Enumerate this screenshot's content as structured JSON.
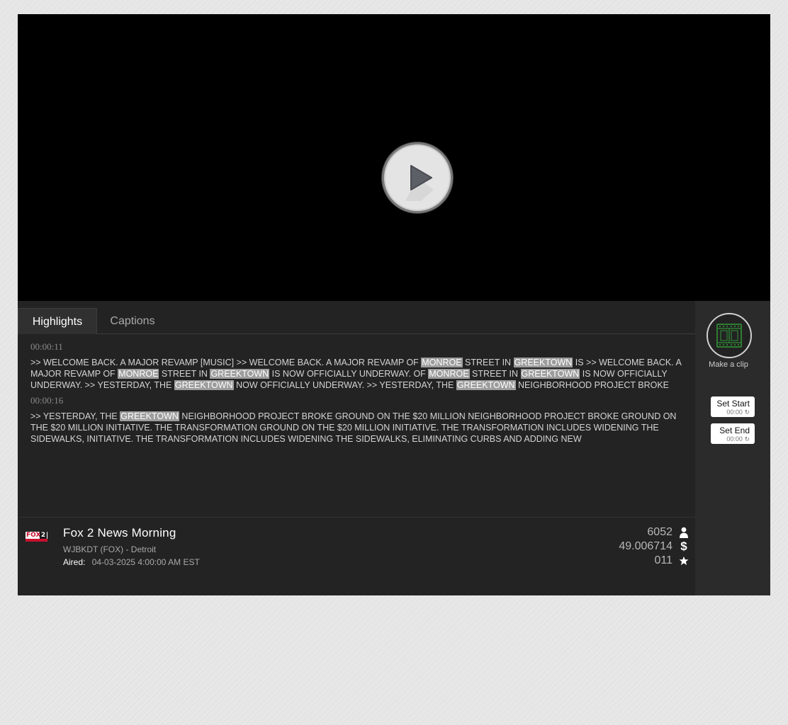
{
  "tabs": {
    "highlights": "Highlights",
    "captions": "Captions"
  },
  "highlights": [
    {
      "timestamp": "00:00:11",
      "segments": [
        {
          "t": ">> WELCOME BACK. A MAJOR REVAMP [MUSIC] >> WELCOME BACK. A MAJOR REVAMP OF "
        },
        {
          "t": "MONROE",
          "hl": true
        },
        {
          "t": " STREET IN "
        },
        {
          "t": "GREEKTOWN",
          "hl": true
        },
        {
          "t": " IS >> WELCOME BACK. A MAJOR REVAMP OF "
        },
        {
          "t": "MONROE",
          "hl": true
        },
        {
          "t": " STREET IN "
        },
        {
          "t": "GREEKTOWN",
          "hl": true
        },
        {
          "t": " IS NOW OFFICIALLY UNDERWAY. OF "
        },
        {
          "t": "MONROE",
          "hl": true
        },
        {
          "t": " STREET IN "
        },
        {
          "t": "GREEKTOWN",
          "hl": true
        },
        {
          "t": " IS NOW OFFICIALLY UNDERWAY. >> YESTERDAY, THE "
        },
        {
          "t": "GREEKTOWN",
          "hl": true
        },
        {
          "t": " NOW OFFICIALLY UNDERWAY. >> YESTERDAY, THE "
        },
        {
          "t": "GREEKTOWN",
          "hl": true
        },
        {
          "t": " NEIGHBORHOOD PROJECT BROKE"
        }
      ]
    },
    {
      "timestamp": "00:00:16",
      "segments": [
        {
          "t": ">> YESTERDAY, THE "
        },
        {
          "t": "GREEKTOWN",
          "hl": true
        },
        {
          "t": " NEIGHBORHOOD PROJECT BROKE GROUND ON THE $20 MILLION NEIGHBORHOOD PROJECT BROKE GROUND ON THE $20 MILLION INITIATIVE. THE TRANSFORMATION GROUND ON THE $20 MILLION INITIATIVE. THE TRANSFORMATION INCLUDES WIDENING THE SIDEWALKS, INITIATIVE. THE TRANSFORMATION INCLUDES WIDENING THE SIDEWALKS, ELIMINATING CURBS AND ADDING NEW"
        }
      ]
    }
  ],
  "program": {
    "title": "Fox 2 News Morning",
    "station": "WJBKDT (FOX) - Detroit",
    "aired_label": "Aired:",
    "aired_value": "04-03-2025 4:00:00 AM EST",
    "logo_text": "FOX",
    "logo_num": "2"
  },
  "stats": {
    "audience": "6052",
    "value": "49.006714",
    "rank": "011"
  },
  "clip": {
    "make_label": "Make a clip",
    "set_start": "Set Start",
    "set_start_time": "00:00",
    "set_end": "Set End",
    "set_end_time": "00:00"
  },
  "colors": {
    "highlight_bg": "#9d9d9d",
    "panel_bg": "#232323",
    "video_bg": "#000000"
  }
}
